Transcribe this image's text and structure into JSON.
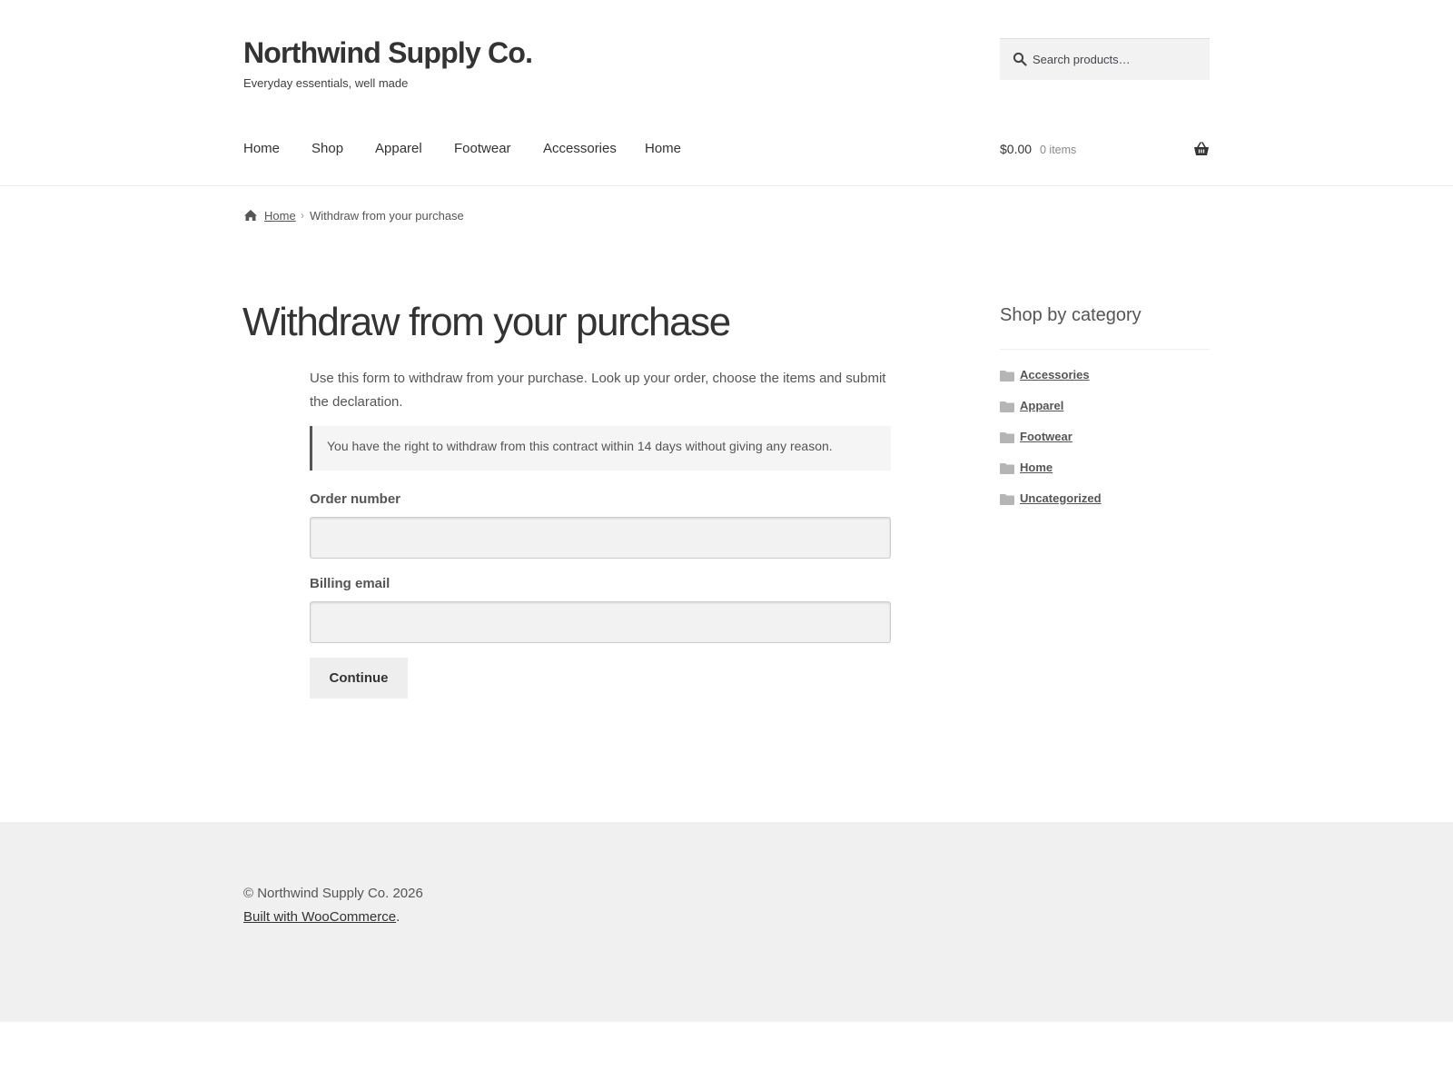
{
  "site": {
    "title": "Northwind Supply Co.",
    "tagline": "Everyday essentials, well made"
  },
  "search": {
    "placeholder": "Search products…"
  },
  "nav": {
    "items": [
      "Home",
      "Shop",
      "Apparel",
      "Footwear",
      "Accessories",
      "Home"
    ]
  },
  "cart": {
    "amount": "$0.00",
    "count": "0 items"
  },
  "breadcrumb": {
    "home": "Home",
    "separator": "›",
    "current": "Withdraw from your purchase"
  },
  "page": {
    "title": "Withdraw from your purchase",
    "intro": "Use this form to withdraw from your purchase. Look up your order, choose the items and submit the declaration.",
    "notice": "You have the right to withdraw from this contract within 14 days without giving any reason."
  },
  "form": {
    "order_label": "Order number",
    "order_value": "",
    "email_label": "Billing email",
    "email_value": "",
    "submit_label": "Continue"
  },
  "sidebar": {
    "widget_title": "Shop by category",
    "categories": [
      "Accessories",
      "Apparel",
      "Footwear",
      "Home",
      "Uncategorized"
    ]
  },
  "footer": {
    "copyright": "© Northwind Supply Co. 2026",
    "credit_link": "Built with WooCommerce",
    "credit_suffix": "."
  },
  "colors": {
    "text": "#43454b",
    "heading": "#333333",
    "footer_bg": "#f0f0f0",
    "notice_border": "#555555"
  },
  "icons": {
    "search": "search-icon",
    "cart": "basket-icon",
    "breadcrumb_home": "house-icon",
    "category": "folder-icon"
  }
}
